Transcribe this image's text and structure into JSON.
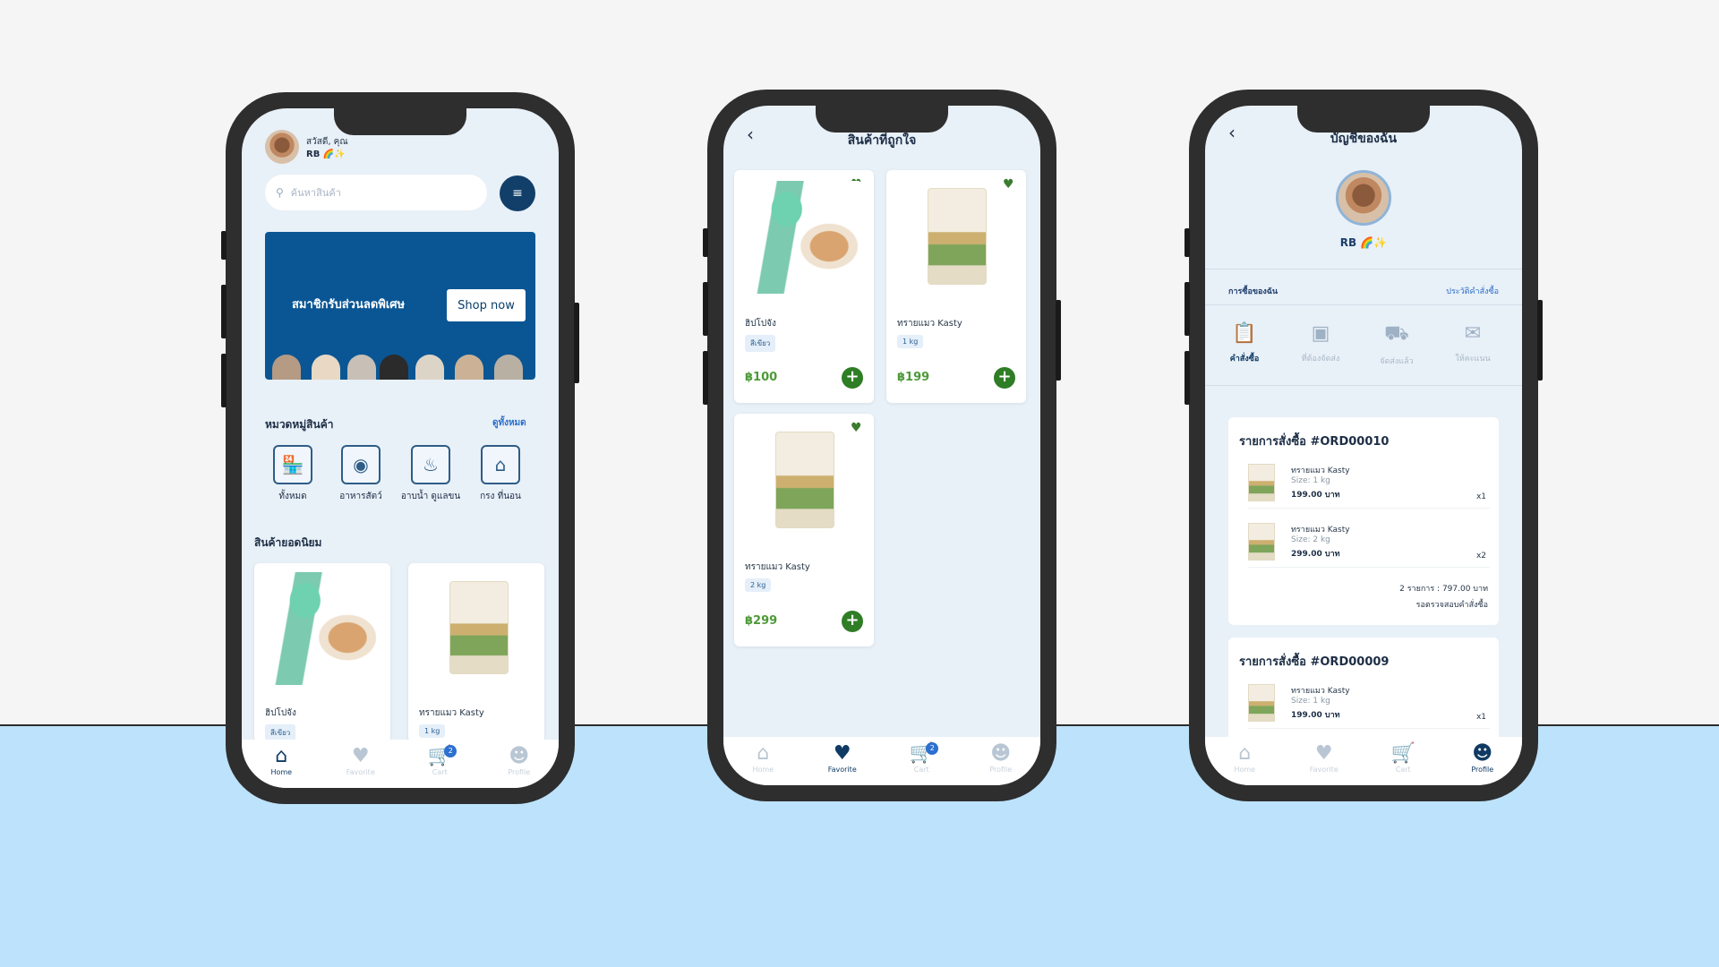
{
  "colors": {
    "primary": "#0f3a63",
    "accent_green": "#2f7d25",
    "banner": "#0a5694",
    "link": "#2b6ecb",
    "background_bottom": "#bde2fb"
  },
  "tabbar": [
    {
      "label": "Home",
      "icon": "home-icon"
    },
    {
      "label": "Favorite",
      "icon": "heart-icon"
    },
    {
      "label": "Cart",
      "icon": "cart-icon",
      "badge": "2"
    },
    {
      "label": "Profile",
      "icon": "person-icon"
    }
  ],
  "home": {
    "greeting": "สวัสดี, คุณ",
    "username": "RB 🌈✨",
    "search_placeholder": "ค้นหาสินค้า",
    "banner_text": "สมาชิกรับส่วนลดพิเศษ",
    "banner_button": "Shop now",
    "categories_title": "หมวดหมู่สินค้า",
    "see_all": "ดูทั้งหมด",
    "categories": [
      {
        "label": "ทั้งหมด",
        "icon": "store-icon"
      },
      {
        "label": "อาหารสัตว์",
        "icon": "pet-food-icon"
      },
      {
        "label": "อาบน้ำ ดูแลขน",
        "icon": "shampoo-icon"
      },
      {
        "label": "กรง ที่นอน",
        "icon": "pet-house-icon"
      }
    ],
    "popular_title": "สินค้ายอดนิยม",
    "products": [
      {
        "name": "ฮิปโปจัง",
        "variant": "สีเขียว"
      },
      {
        "name": "ทรายแมว Kasty",
        "variant": "1 kg"
      }
    ]
  },
  "favorites": {
    "title": "สินค้าที่ถูกใจ",
    "items": [
      {
        "name": "ฮิปโปจัง",
        "variant": "สีเขียว",
        "price": "฿100"
      },
      {
        "name": "ทรายแมว Kasty",
        "variant": "1 kg",
        "price": "฿199"
      },
      {
        "name": "ทรายแมว Kasty",
        "variant": "2 kg",
        "price": "฿299"
      }
    ]
  },
  "profile": {
    "title": "บัญชีของฉัน",
    "username": "RB 🌈✨",
    "my_purchases": "การซื้อของฉัน",
    "order_history": "ประวัติคำสั่งซื้อ",
    "status_tabs": [
      {
        "label": "คำสั่งซื้อ",
        "icon": "clipboard-icon"
      },
      {
        "label": "ที่ต้องจัดส่ง",
        "icon": "box-icon"
      },
      {
        "label": "จัดส่งแล้ว",
        "icon": "truck-icon"
      },
      {
        "label": "ให้คะแนน",
        "icon": "chat-icon"
      }
    ],
    "orders": [
      {
        "title": "รายการสั่งซื้อ #ORD00010",
        "items": [
          {
            "name": "ทรายแมว Kasty",
            "size": "Size: 1 kg",
            "price": "199.00 บาท",
            "qty": "x1"
          },
          {
            "name": "ทรายแมว Kasty",
            "size": "Size: 2 kg",
            "price": "299.00 บาท",
            "qty": "x2"
          }
        ],
        "summary": "2 รายการ : 797.00 บาท",
        "status": "รอตรวจสอบคำสั่งซื้อ"
      },
      {
        "title": "รายการสั่งซื้อ #ORD00009",
        "items": [
          {
            "name": "ทรายแมว Kasty",
            "size": "Size: 1 kg",
            "price": "199.00 บาท",
            "qty": "x1"
          }
        ]
      }
    ]
  }
}
